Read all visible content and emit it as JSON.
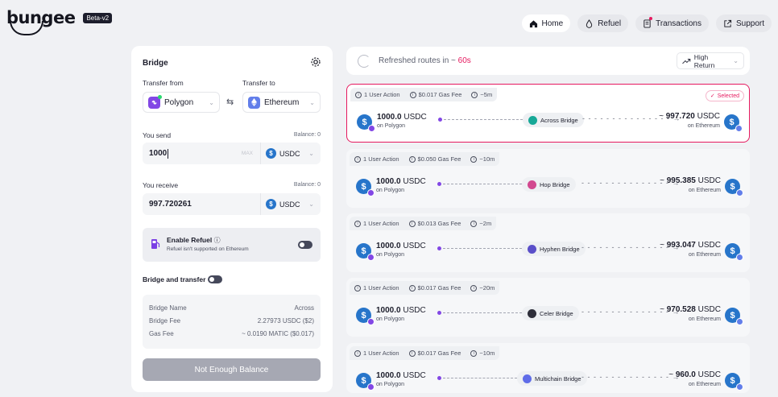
{
  "brand": {
    "name": "bungee",
    "badge": "Beta-v2"
  },
  "nav": [
    {
      "label": "Home",
      "icon": "home-icon",
      "active": true
    },
    {
      "label": "Refuel",
      "icon": "fuel-drop-icon",
      "active": false
    },
    {
      "label": "Transactions",
      "icon": "document-icon",
      "active": false
    },
    {
      "label": "Support",
      "icon": "external-link-icon",
      "active": false
    }
  ],
  "bridge": {
    "title": "Bridge",
    "transfer_from_label": "Transfer from",
    "transfer_to_label": "Transfer to",
    "from_chain": "Polygon",
    "to_chain": "Ethereum",
    "you_send_label": "You send",
    "send_balance": "Balance: 0",
    "send_amount": "1000",
    "max_label": "MAX",
    "send_token": "USDC",
    "you_receive_label": "You receive",
    "receive_balance": "Balance: 0",
    "receive_amount": "997.720261",
    "receive_token": "USDC",
    "refuel_title": "Enable Refuel",
    "refuel_note": "Refuel isn't supported on Ethereum",
    "bridge_and_transfer": "Bridge and transfer",
    "summary": [
      {
        "label": "Bridge Name",
        "value": "Across"
      },
      {
        "label": "Bridge Fee",
        "value": "2.27973 USDC ($2)"
      },
      {
        "label": "Gas Fee",
        "value": "~ 0.0190 MATIC ($0.017)"
      }
    ],
    "action_button": "Not Enough Balance"
  },
  "routes_header": {
    "refresh_prefix": "Refreshed routes in ~",
    "refresh_time": "60s",
    "sort_label": "High Return"
  },
  "routes": [
    {
      "actions": "1 User Action",
      "gas": "$0.017 Gas Fee",
      "time": "~5m",
      "selected_label": "Selected",
      "amount": "1000.0",
      "token": "USDC",
      "from": "on Polygon",
      "bridge": "Across Bridge",
      "bridge_icon": "across-icon",
      "out_amount": "997.720",
      "out_token": "USDC",
      "to": "on Ethereum",
      "selected": true,
      "color": "#17a897"
    },
    {
      "actions": "1 User Action",
      "gas": "$0.050 Gas Fee",
      "time": "~10m",
      "amount": "1000.0",
      "token": "USDC",
      "from": "on Polygon",
      "bridge": "Hop Bridge",
      "bridge_icon": "hop-icon",
      "out_amount": "995.385",
      "out_token": "USDC",
      "to": "on Ethereum",
      "selected": false,
      "color": "#d2488f"
    },
    {
      "actions": "1 User Action",
      "gas": "$0.013 Gas Fee",
      "time": "~2m",
      "amount": "1000.0",
      "token": "USDC",
      "from": "on Polygon",
      "bridge": "Hyphen Bridge",
      "bridge_icon": "hyphen-icon",
      "out_amount": "993.047",
      "out_token": "USDC",
      "to": "on Ethereum",
      "selected": false,
      "color": "#5a4fc9"
    },
    {
      "actions": "1 User Action",
      "gas": "$0.017 Gas Fee",
      "time": "~20m",
      "amount": "1000.0",
      "token": "USDC",
      "from": "on Polygon",
      "bridge": "Celer Bridge",
      "bridge_icon": "celer-icon",
      "out_amount": "970.528",
      "out_token": "USDC",
      "to": "on Ethereum",
      "selected": false,
      "color": "#2e2e3a"
    },
    {
      "actions": "1 User Action",
      "gas": "$0.017 Gas Fee",
      "time": "~10m",
      "amount": "1000.0",
      "token": "USDC",
      "from": "on Polygon",
      "bridge": "Multichain Bridge",
      "bridge_icon": "multichain-icon",
      "out_amount": "960.0",
      "out_token": "USDC",
      "to": "on Ethereum",
      "selected": false,
      "color": "#5f6ce8"
    }
  ]
}
